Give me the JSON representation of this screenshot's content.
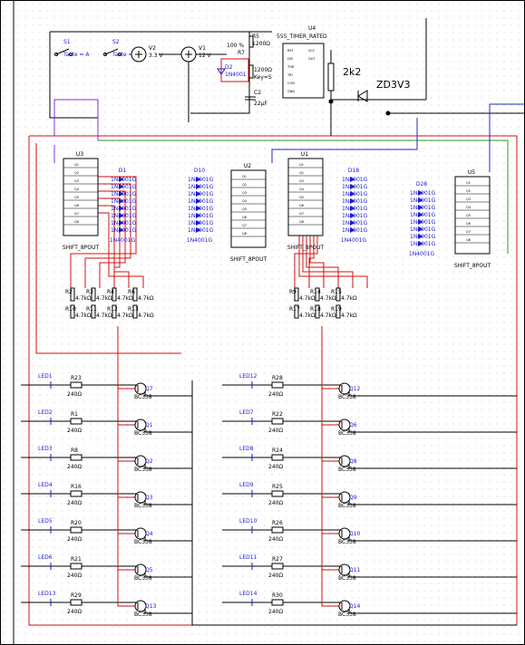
{
  "switches": {
    "s1": "S1",
    "s2": "S2",
    "s1_key": "Taste = A",
    "s2_key": "Taste = B"
  },
  "sources": {
    "v2": "V2",
    "v2_val": "3.3 V",
    "v1": "V1",
    "v1_val": "12 V"
  },
  "timer": {
    "r5": "R5",
    "r5_val": "1200Ω",
    "pct": "100 %",
    "r7": "R7",
    "r7_val": "1200Ω",
    "r7_key": "Key=S",
    "d2": "D2",
    "d2_part": "1N4001",
    "c2": "C2",
    "c2_val": "22µF",
    "u4": "U4",
    "u4_part": "555_TIMER_RATED",
    "pins_left": [
      "RST",
      "DIS",
      "THR",
      "TRI",
      "CON",
      "GND"
    ],
    "pins_right": [
      "VCC",
      "OUT"
    ]
  },
  "zener": {
    "ref": "ZD3V3",
    "res": "2k2"
  },
  "shift_registers": [
    {
      "ref": "U3",
      "part": "SHIFT_8POUT"
    },
    {
      "ref": "U2",
      "part": "SHIFT_8POUT"
    },
    {
      "ref": "U1",
      "part": "SHIFT_8POUT"
    },
    {
      "ref": "U5",
      "part": "SHIFT_8POUT"
    }
  ],
  "sr_pins": [
    "DATA",
    "CLK",
    "Q1",
    "Q2",
    "Q3",
    "Q4",
    "Q5",
    "Q6",
    "Q7",
    "Q8"
  ],
  "diode_arrays": [
    {
      "ref": "D1",
      "part": "1N4001G"
    },
    {
      "ref": "D10",
      "part": "1N4001G"
    },
    {
      "ref": "D18",
      "part": "1N4001G"
    },
    {
      "ref": "D28",
      "part": "1N4001G"
    }
  ],
  "resistor_nets": {
    "left_top": [
      {
        "ref": "R2",
        "val": "4.7kΩ"
      },
      {
        "ref": "R3",
        "val": "4.7kΩ"
      },
      {
        "ref": "R4",
        "val": "4.7kΩ"
      },
      {
        "ref": "R6",
        "val": "4.7kΩ"
      }
    ],
    "left_bottom": [
      {
        "ref": "R10",
        "val": "4.7kΩ"
      },
      {
        "ref": "R11",
        "val": "4.7kΩ"
      },
      {
        "ref": "R12",
        "val": "4.7kΩ"
      },
      {
        "ref": "R13",
        "val": "4.7kΩ"
      }
    ],
    "right_top": [
      {
        "ref": "R9",
        "val": "4.7kΩ"
      },
      {
        "ref": "R14",
        "val": "4.7kΩ"
      },
      {
        "ref": "R15",
        "val": "4.7kΩ"
      }
    ],
    "right_bottom": [
      {
        "ref": "R17",
        "val": "4.7kΩ"
      },
      {
        "ref": "R18",
        "val": "4.7kΩ"
      },
      {
        "ref": "R19",
        "val": "4.7kΩ"
      }
    ]
  },
  "led_rows_left": [
    {
      "led": "LED1",
      "res": "R23",
      "val": "240Ω",
      "q": "Q7",
      "part": "BC338"
    },
    {
      "led": "LED2",
      "res": "R1",
      "val": "240Ω",
      "q": "Q1",
      "part": "BC338"
    },
    {
      "led": "LED3",
      "res": "R8",
      "val": "240Ω",
      "q": "Q2",
      "part": "BC338"
    },
    {
      "led": "LED4",
      "res": "R16",
      "val": "240Ω",
      "q": "Q3",
      "part": "BC338"
    },
    {
      "led": "LED5",
      "res": "R20",
      "val": "240Ω",
      "q": "Q4",
      "part": "BC338"
    },
    {
      "led": "LED6",
      "res": "R21",
      "val": "240Ω",
      "q": "Q5",
      "part": "BC338"
    },
    {
      "led": "LED13",
      "res": "R29",
      "val": "240Ω",
      "q": "Q13",
      "part": "BC338"
    }
  ],
  "led_rows_right": [
    {
      "led": "LED12",
      "res": "R28",
      "val": "240Ω",
      "q": "Q12",
      "part": "BC338"
    },
    {
      "led": "LED7",
      "res": "R22",
      "val": "240Ω",
      "q": "Q6",
      "part": "BC338"
    },
    {
      "led": "LED8",
      "res": "R24",
      "val": "240Ω",
      "q": "Q8",
      "part": "BC338"
    },
    {
      "led": "LED9",
      "res": "R25",
      "val": "240Ω",
      "q": "Q9",
      "part": "BC338"
    },
    {
      "led": "LED10",
      "res": "R26",
      "val": "240Ω",
      "q": "Q10",
      "part": "BC338"
    },
    {
      "led": "LED11",
      "res": "R27",
      "val": "240Ω",
      "q": "Q11",
      "part": "BC338"
    },
    {
      "led": "LED14",
      "res": "R30",
      "val": "240Ω",
      "q": "Q14",
      "part": "BC338"
    }
  ],
  "colors": {
    "wire_red": "#d01010",
    "wire_purple": "#8a2be2",
    "wire_green": "#2a9a2a",
    "wire_blue": "#1c2fb0",
    "wire_black": "#000000",
    "diode_blue": "#1a1ad0"
  }
}
